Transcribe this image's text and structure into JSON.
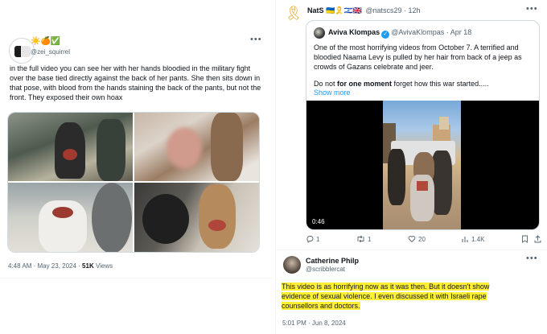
{
  "left_tweet": {
    "name": "☀️🍊✅",
    "handle": "@zei_squirrel",
    "more_icon": "more-dots",
    "text": "in the full video you can see her with her hands  bloodied in the military fight over the base tied directly against the back of her pants. She then sits down in that pose, with blood from the hands staining the back of the pants, but not the front. They exposed their own hoax",
    "time": "4:48 AM · May 23, 2024 · ",
    "views_count": "51K",
    "views_label": " Views"
  },
  "right_tweet": {
    "ribbon_icon": "yellow-ribbon",
    "name": "NatS",
    "name_emojis": "🇺🇦🎗️🇮🇱🇬🇧",
    "handle_time": "@natscs29 · 12h",
    "quote": {
      "name": "Aviva Klompas",
      "handle_time": "@AvivaKlompas · Apr 18",
      "text": "One of the most horrifying videos from October 7. A terrified and bloodied Naama Levy is pulled by her hair from back of a jeep as crowds of Gazans celebrate and jeer.",
      "text2_pre": "Do not ",
      "text2_bold": "for one moment",
      "text2_post": " forget how this war started.....",
      "show_more": "Show more",
      "video_duration": "0:46"
    },
    "actions": {
      "reply_count": "1",
      "repost_count": "1",
      "like_count": "20",
      "views_count": "1.4K"
    }
  },
  "reply_tweet": {
    "name": "Catherine Philp",
    "handle": "@scribblercat",
    "text": "This video is as horrifying now as it was then. But it doesn't show evidence of sexual violence. I even discussed it with Israeli rape counsellors and doctors.",
    "time": "5:01 PM · Jun 8, 2024"
  }
}
